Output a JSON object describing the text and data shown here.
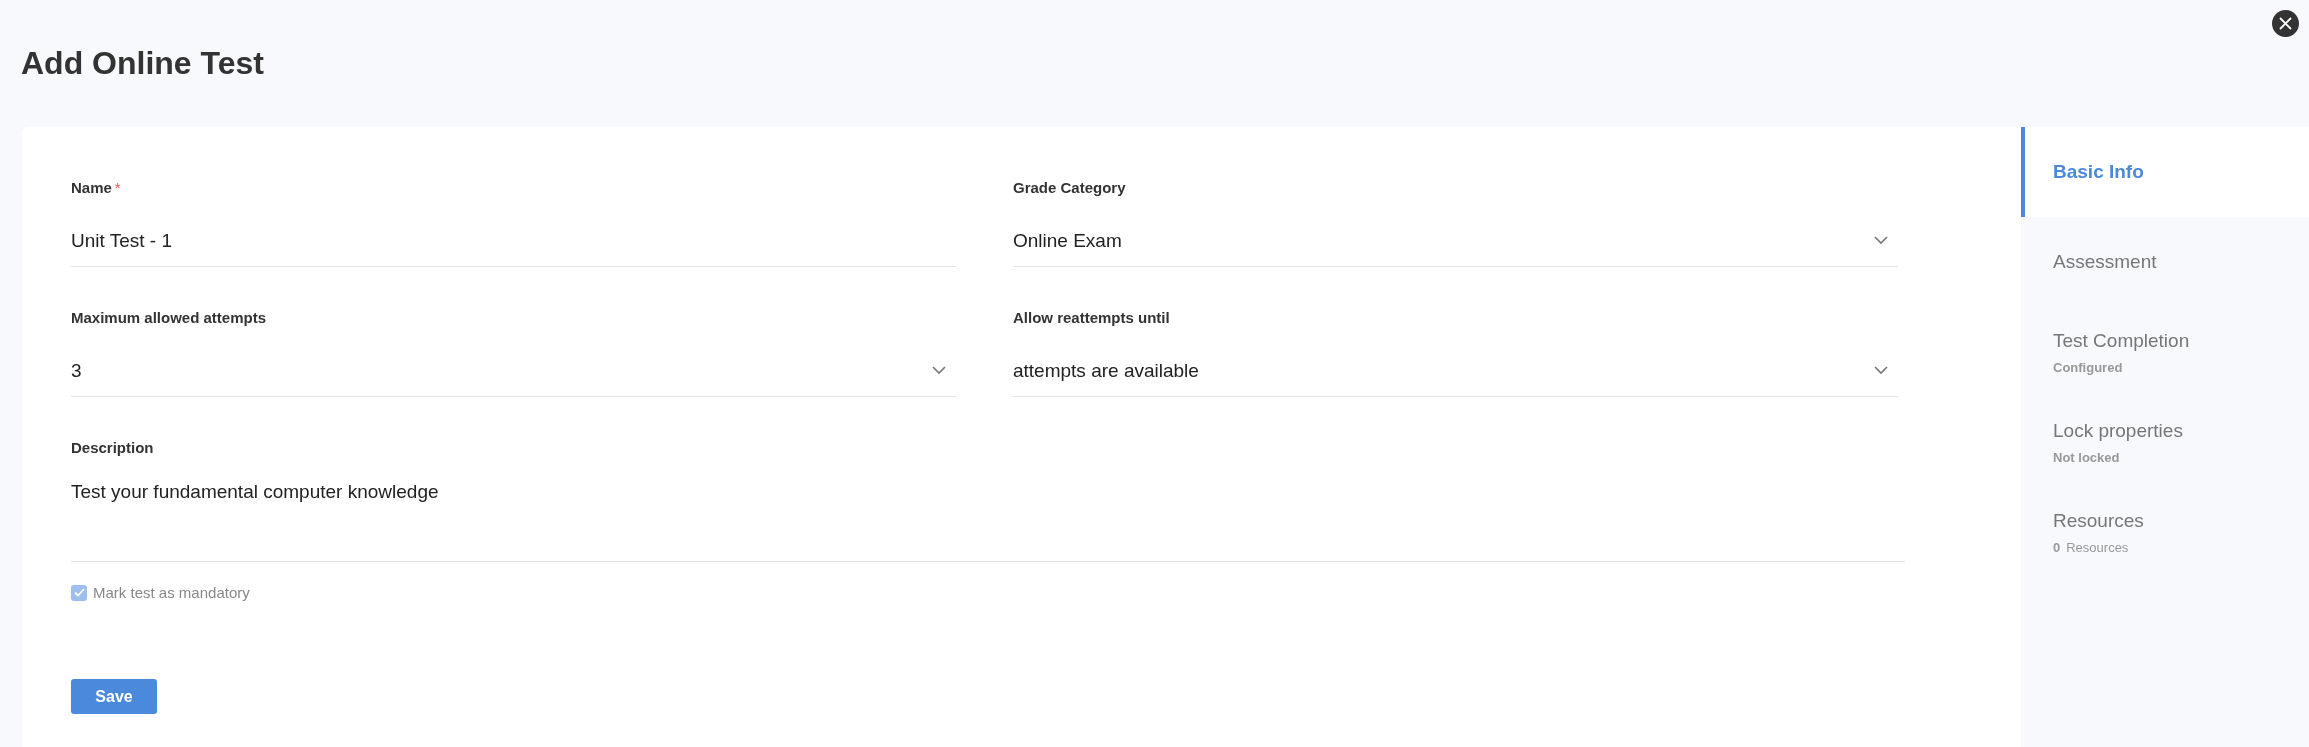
{
  "title": "Add Online Test",
  "form": {
    "fields": [
      {
        "label": "Name",
        "required_mark": "*",
        "value": "Unit Test - 1",
        "kind": "text"
      },
      {
        "label": "Grade Category",
        "value": "Online Exam",
        "kind": "select"
      },
      {
        "label": "Maximum allowed attempts",
        "value": "3",
        "kind": "select"
      },
      {
        "label": "Allow reattempts until",
        "value": "attempts are available",
        "kind": "select"
      }
    ],
    "description": {
      "label": "Description",
      "value": "Test your fundamental computer knowledge"
    },
    "mandatory": {
      "label": "Mark test as mandatory",
      "checked": true
    },
    "save_button": "Save"
  },
  "sidebar": {
    "items": [
      {
        "label": "Basic Info",
        "selected": true
      },
      {
        "label": "Assessment",
        "selected": false
      },
      {
        "label": "Test Completion",
        "status": "Configured",
        "selected": false
      },
      {
        "label": "Lock properties",
        "status": "Not locked",
        "selected": false
      },
      {
        "label": "Resources",
        "count": "0",
        "status": "Resources",
        "selected": false
      }
    ]
  }
}
